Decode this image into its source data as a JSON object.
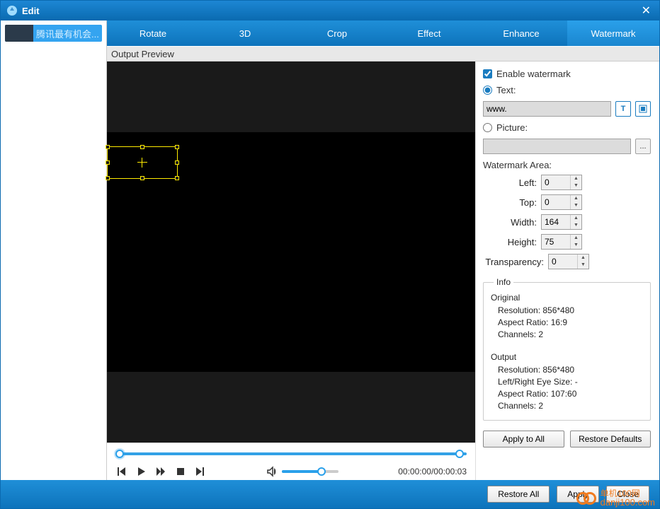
{
  "titlebar": {
    "title": "Edit"
  },
  "file": {
    "name": "腾讯最有机会..."
  },
  "tabs": [
    "Rotate",
    "3D",
    "Crop",
    "Effect",
    "Enhance",
    "Watermark"
  ],
  "active_tab_index": 5,
  "preview_label": "Output Preview",
  "panel": {
    "enable_label": "Enable watermark",
    "text_label": "Text:",
    "text_value": "www.",
    "picture_label": "Picture:",
    "area_label": "Watermark Area:",
    "left_label": "Left:",
    "left_value": "0",
    "top_label": "Top:",
    "top_value": "0",
    "width_label": "Width:",
    "width_value": "164",
    "height_label": "Height:",
    "height_value": "75",
    "transparency_label": "Transparency:",
    "transparency_value": "0"
  },
  "info": {
    "legend": "Info",
    "original_head": "Original",
    "original_resolution": "Resolution: 856*480",
    "original_ar": "Aspect Ratio: 16:9",
    "original_channels": "Channels: 2",
    "output_head": "Output",
    "output_resolution": "Resolution: 856*480",
    "output_lr": "Left/Right Eye Size: -",
    "output_ar": "Aspect Ratio: 107:60",
    "output_channels": "Channels: 2"
  },
  "buttons": {
    "apply_all": "Apply to All",
    "restore_defaults": "Restore Defaults",
    "restore_all": "Restore All",
    "apply": "Apply",
    "close": "Close"
  },
  "timecode": "00:00:00/00:00:03",
  "brand": {
    "cn": "单机100网",
    "url": "danji100.com"
  }
}
